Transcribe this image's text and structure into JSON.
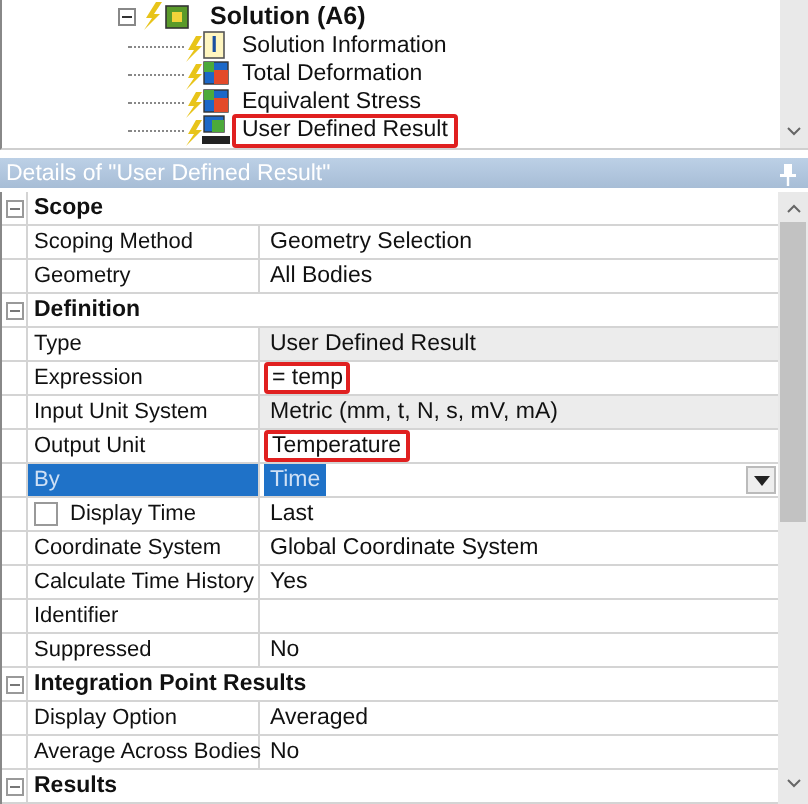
{
  "tree": {
    "label": "Solution (A6)",
    "expanded": true,
    "children": [
      {
        "label": "Solution Information",
        "kind": "info",
        "highlighted": false
      },
      {
        "label": "Total Deformation",
        "kind": "result",
        "highlighted": false
      },
      {
        "label": "Equivalent Stress",
        "kind": "result",
        "highlighted": false
      },
      {
        "label": "User Defined Result",
        "kind": "user",
        "highlighted": true
      }
    ]
  },
  "details": {
    "title": "Details of \"User Defined Result\"",
    "groups": [
      {
        "label": "Scope",
        "expanded": true,
        "rows": [
          {
            "name": "Scoping Method",
            "value": "Geometry Selection",
            "kind": "text",
            "readonly": false,
            "selected": false
          },
          {
            "name": "Geometry",
            "value": "All Bodies",
            "kind": "text",
            "readonly": false,
            "selected": false
          }
        ]
      },
      {
        "label": "Definition",
        "expanded": true,
        "rows": [
          {
            "name": "Type",
            "value": "User Defined Result",
            "kind": "text",
            "readonly": true,
            "selected": false
          },
          {
            "name": "Expression",
            "value": "= temp",
            "kind": "text",
            "readonly": false,
            "selected": false,
            "highlighted": true
          },
          {
            "name": "Input Unit System",
            "value": "Metric (mm, t, N, s, mV, mA)",
            "kind": "text",
            "readonly": true,
            "selected": false
          },
          {
            "name": "Output Unit",
            "value": "Temperature",
            "kind": "text",
            "readonly": false,
            "selected": false,
            "highlighted": true
          },
          {
            "name": "By",
            "value": "Time",
            "kind": "dropdown",
            "readonly": false,
            "selected": true
          },
          {
            "name": "Display Time",
            "value": "Last",
            "kind": "checkbox",
            "checked": false,
            "readonly": false,
            "selected": false
          },
          {
            "name": "Coordinate System",
            "value": "Global Coordinate System",
            "kind": "text",
            "readonly": false,
            "selected": false
          },
          {
            "name": "Calculate Time History",
            "value": "Yes",
            "kind": "text",
            "readonly": false,
            "selected": false
          },
          {
            "name": "Identifier",
            "kind": "text",
            "readonly": false,
            "selected": false
          },
          {
            "name": "Suppressed",
            "value": "No",
            "kind": "text",
            "readonly": false,
            "selected": false
          }
        ]
      },
      {
        "label": "Integration Point Results",
        "expanded": true,
        "rows": [
          {
            "name": "Display Option",
            "value": "Averaged",
            "kind": "text",
            "readonly": false,
            "selected": false
          },
          {
            "name": "Average Across Bodies",
            "value": "No",
            "kind": "text",
            "readonly": false,
            "selected": false
          }
        ]
      },
      {
        "label": "Results",
        "expanded": true
      }
    ]
  }
}
